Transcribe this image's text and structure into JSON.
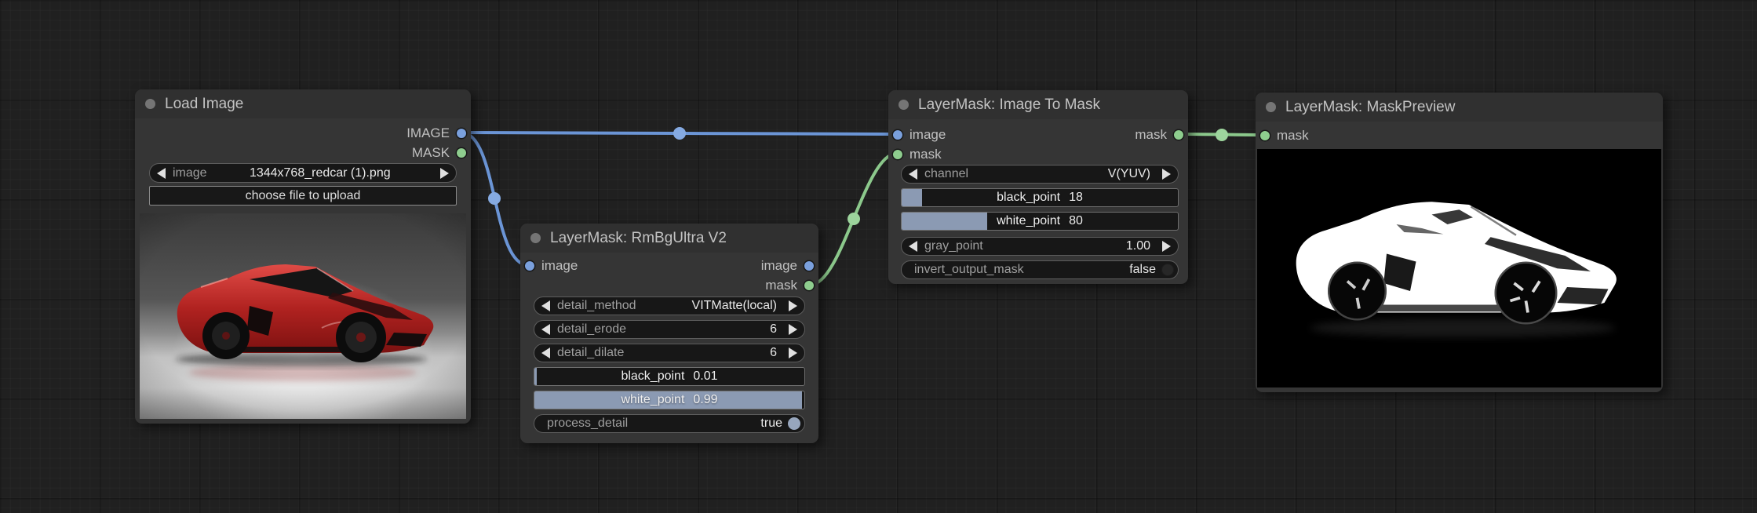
{
  "app": "ComfyUI node graph",
  "colors": {
    "canvas_bg": "#202020",
    "node_bg": "#353535",
    "node_title_bg": "#303030",
    "image_wire": "#6b95d6",
    "image_wire_dot": "#85aae2",
    "mask_wire": "#8cc98c",
    "mask_wire_dot": "#9dd59d",
    "image_port": "#7aa0dd",
    "mask_port": "#8ecd8e",
    "slider_fill": "#8b9ab3"
  },
  "nodes": {
    "load_image": {
      "title": "Load Image",
      "outputs": [
        {
          "label": "IMAGE",
          "type": "image"
        },
        {
          "label": "MASK",
          "type": "mask"
        }
      ],
      "widgets": {
        "image_combo": {
          "label": "image",
          "value": "1344x768_redcar (1).png"
        },
        "upload_button": {
          "label": "choose file to upload"
        }
      },
      "preview": "red sports car studio photo"
    },
    "rmbg": {
      "title": "LayerMask: RmBgUltra V2",
      "inputs": [
        {
          "label": "image",
          "type": "image"
        }
      ],
      "outputs": [
        {
          "label": "image",
          "type": "image"
        },
        {
          "label": "mask",
          "type": "mask"
        }
      ],
      "widgets": {
        "detail_method": {
          "label": "detail_method",
          "value": "VITMatte(local)"
        },
        "detail_erode": {
          "label": "detail_erode",
          "value": "6"
        },
        "detail_dilate": {
          "label": "detail_dilate",
          "value": "6"
        },
        "black_point": {
          "label": "black_point",
          "value": "0.01",
          "fill": 0.01
        },
        "white_point": {
          "label": "white_point",
          "value": "0.99",
          "fill": 0.99
        },
        "process_detail": {
          "label": "process_detail",
          "value": "true"
        }
      }
    },
    "image_to_mask": {
      "title": "LayerMask: Image To Mask",
      "inputs": [
        {
          "label": "image",
          "type": "image"
        },
        {
          "label": "mask",
          "type": "mask"
        }
      ],
      "outputs": [
        {
          "label": "mask",
          "type": "mask"
        }
      ],
      "widgets": {
        "channel": {
          "label": "channel",
          "value": "V(YUV)"
        },
        "black_point": {
          "label": "black_point",
          "value": "18",
          "fill": 0.075
        },
        "white_point": {
          "label": "white_point",
          "value": "80",
          "fill": 0.31
        },
        "gray_point": {
          "label": "gray_point",
          "value": "1.00"
        },
        "invert_output_mask": {
          "label": "invert_output_mask",
          "value": "false"
        }
      }
    },
    "mask_preview": {
      "title": "LayerMask: MaskPreview",
      "inputs": [
        {
          "label": "mask",
          "type": "mask"
        }
      ],
      "preview": "white car mask on black"
    }
  },
  "links": [
    {
      "from": "Load Image.IMAGE",
      "to": "LayerMask: Image To Mask.image",
      "type": "image"
    },
    {
      "from": "Load Image.IMAGE",
      "to": "LayerMask: RmBgUltra V2.image",
      "type": "image"
    },
    {
      "from": "LayerMask: RmBgUltra V2.mask",
      "to": "LayerMask: Image To Mask.mask",
      "type": "mask"
    },
    {
      "from": "LayerMask: Image To Mask.mask",
      "to": "LayerMask: MaskPreview.mask",
      "type": "mask"
    }
  ]
}
